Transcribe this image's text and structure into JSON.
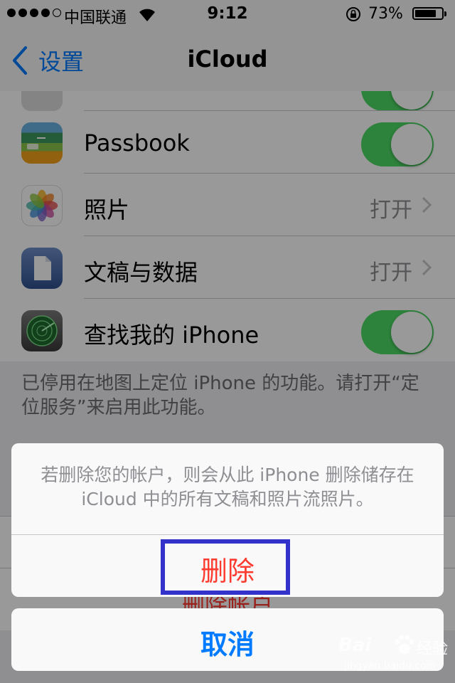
{
  "status_bar": {
    "carrier": "中国联通",
    "time": "9:12",
    "battery": "73%"
  },
  "nav": {
    "back_label": "设置",
    "title": "iCloud"
  },
  "settings": {
    "rows": [
      {
        "label": "Passbook",
        "icon": "passbook-icon",
        "toggle": true
      },
      {
        "label": "照片",
        "icon": "photos-icon",
        "value": "打开"
      },
      {
        "label": "文稿与数据",
        "icon": "document-icon",
        "value": "打开"
      },
      {
        "label": "查找我的 iPhone",
        "icon": "radar-icon",
        "toggle": true
      }
    ],
    "footer_note": "已停用在地图上定位 iPhone 的功能。请打开“定位服务”来启用此功能。"
  },
  "background": {
    "delete_account_label": "删除帐户"
  },
  "action_sheet": {
    "message": "若删除您的帐户，则会从此 iPhone 删除储存在 iCloud 中的所有文稿和照片流照片。",
    "delete_label": "删除",
    "cancel_label": "取消"
  },
  "watermark": {
    "brand": "Bai",
    "suffix": "经验",
    "url": "jingyan.baidu.com"
  },
  "colors": {
    "ios_blue": "#007aff",
    "destructive_red": "#ff3b30",
    "toggle_green": "#4cd964",
    "highlight_box": "#3333cc"
  }
}
